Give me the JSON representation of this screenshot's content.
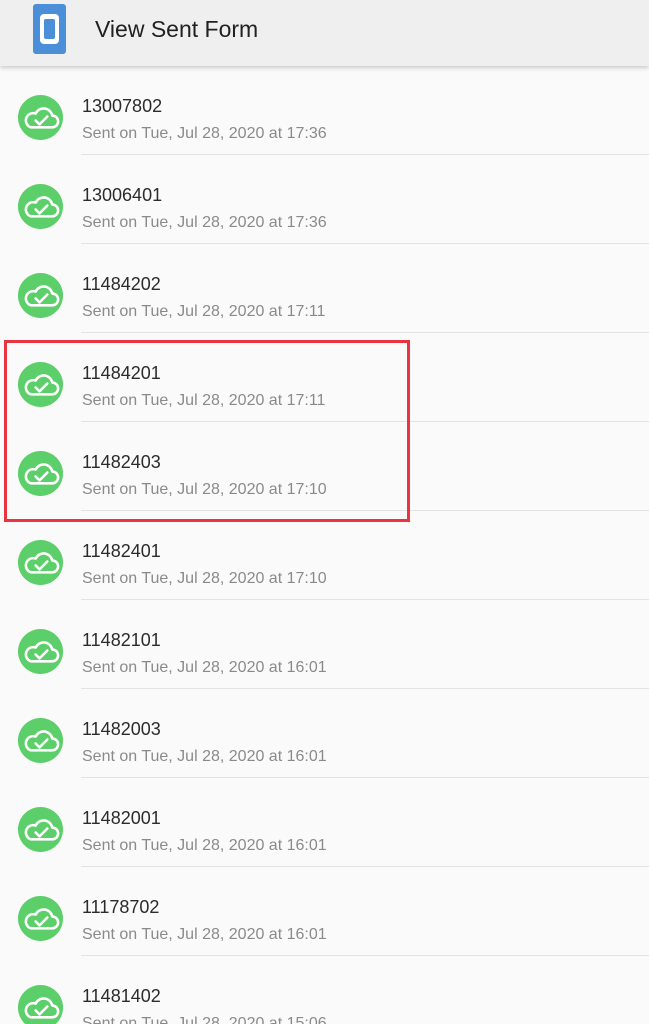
{
  "appbar": {
    "title": "View Sent Form",
    "icon": "app-logo-icon",
    "icon_color": "#4a8fd8"
  },
  "status_icon": {
    "name": "cloud-check-icon",
    "color": "#5ccf6a"
  },
  "highlight": {
    "color": "#e8353f",
    "covers_rows": [
      3,
      4
    ]
  },
  "forms": [
    {
      "id": "13007802",
      "sent": "Sent on Tue, Jul 28, 2020 at 17:36"
    },
    {
      "id": "13006401",
      "sent": "Sent on Tue, Jul 28, 2020 at 17:36"
    },
    {
      "id": "11484202",
      "sent": "Sent on Tue, Jul 28, 2020 at 17:11"
    },
    {
      "id": "11484201",
      "sent": "Sent on Tue, Jul 28, 2020 at 17:11"
    },
    {
      "id": "11482403",
      "sent": "Sent on Tue, Jul 28, 2020 at 17:10"
    },
    {
      "id": "11482401",
      "sent": "Sent on Tue, Jul 28, 2020 at 17:10"
    },
    {
      "id": "11482101",
      "sent": "Sent on Tue, Jul 28, 2020 at 16:01"
    },
    {
      "id": "11482003",
      "sent": "Sent on Tue, Jul 28, 2020 at 16:01"
    },
    {
      "id": "11482001",
      "sent": "Sent on Tue, Jul 28, 2020 at 16:01"
    },
    {
      "id": "11178702",
      "sent": "Sent on Tue, Jul 28, 2020 at 16:01"
    },
    {
      "id": "11481402",
      "sent": "Sent on Tue, Jul 28, 2020 at 15:06"
    }
  ]
}
